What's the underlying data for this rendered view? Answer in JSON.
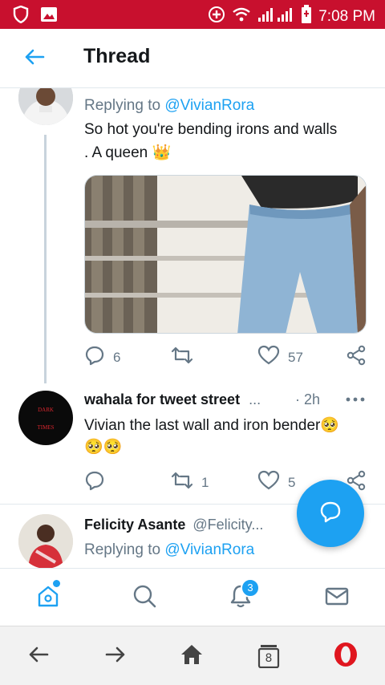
{
  "status_bar": {
    "time": "7:08 PM"
  },
  "header": {
    "title": "Thread"
  },
  "tweets": [
    {
      "replying_prefix": "Replying to ",
      "replying_handle": "@VivianRora",
      "text_line1": "So hot you're bending irons and walls",
      "text_line2": ". A queen 👑",
      "replies": "6",
      "retweets": "",
      "likes": "57"
    },
    {
      "name": "wahala for tweet street",
      "ellipsis": "...",
      "time": "· 2h",
      "text_line1": "Vivian the last wall and iron bender🥺",
      "text_line2": "🥺🥺",
      "avatar_text1": "DARK",
      "avatar_text2": "TIMES",
      "replies": "",
      "retweets": "1",
      "likes": "5"
    },
    {
      "name": "Felicity Asante",
      "handle": "@Felicity...",
      "replying_prefix": "Replying to ",
      "replying_handle": "@VivianRora"
    }
  ],
  "tab_bar": {
    "notifications_badge": "3"
  },
  "browser_bar": {
    "tabs_count": "8"
  },
  "colors": {
    "accent": "#1da1f2",
    "status_bar": "#c8102e",
    "muted": "#657786"
  },
  "icons": [
    "shield-icon",
    "image-icon",
    "hotspot-icon",
    "wifi-icon",
    "signal-icon",
    "battery-icon",
    "back-arrow-icon",
    "reply-icon",
    "retweet-icon",
    "like-icon",
    "share-icon",
    "more-icon",
    "compose-reply-icon",
    "home-icon",
    "search-icon",
    "bell-icon",
    "mail-icon",
    "browser-back-icon",
    "browser-forward-icon",
    "browser-home-icon",
    "tabs-icon",
    "opera-icon"
  ]
}
